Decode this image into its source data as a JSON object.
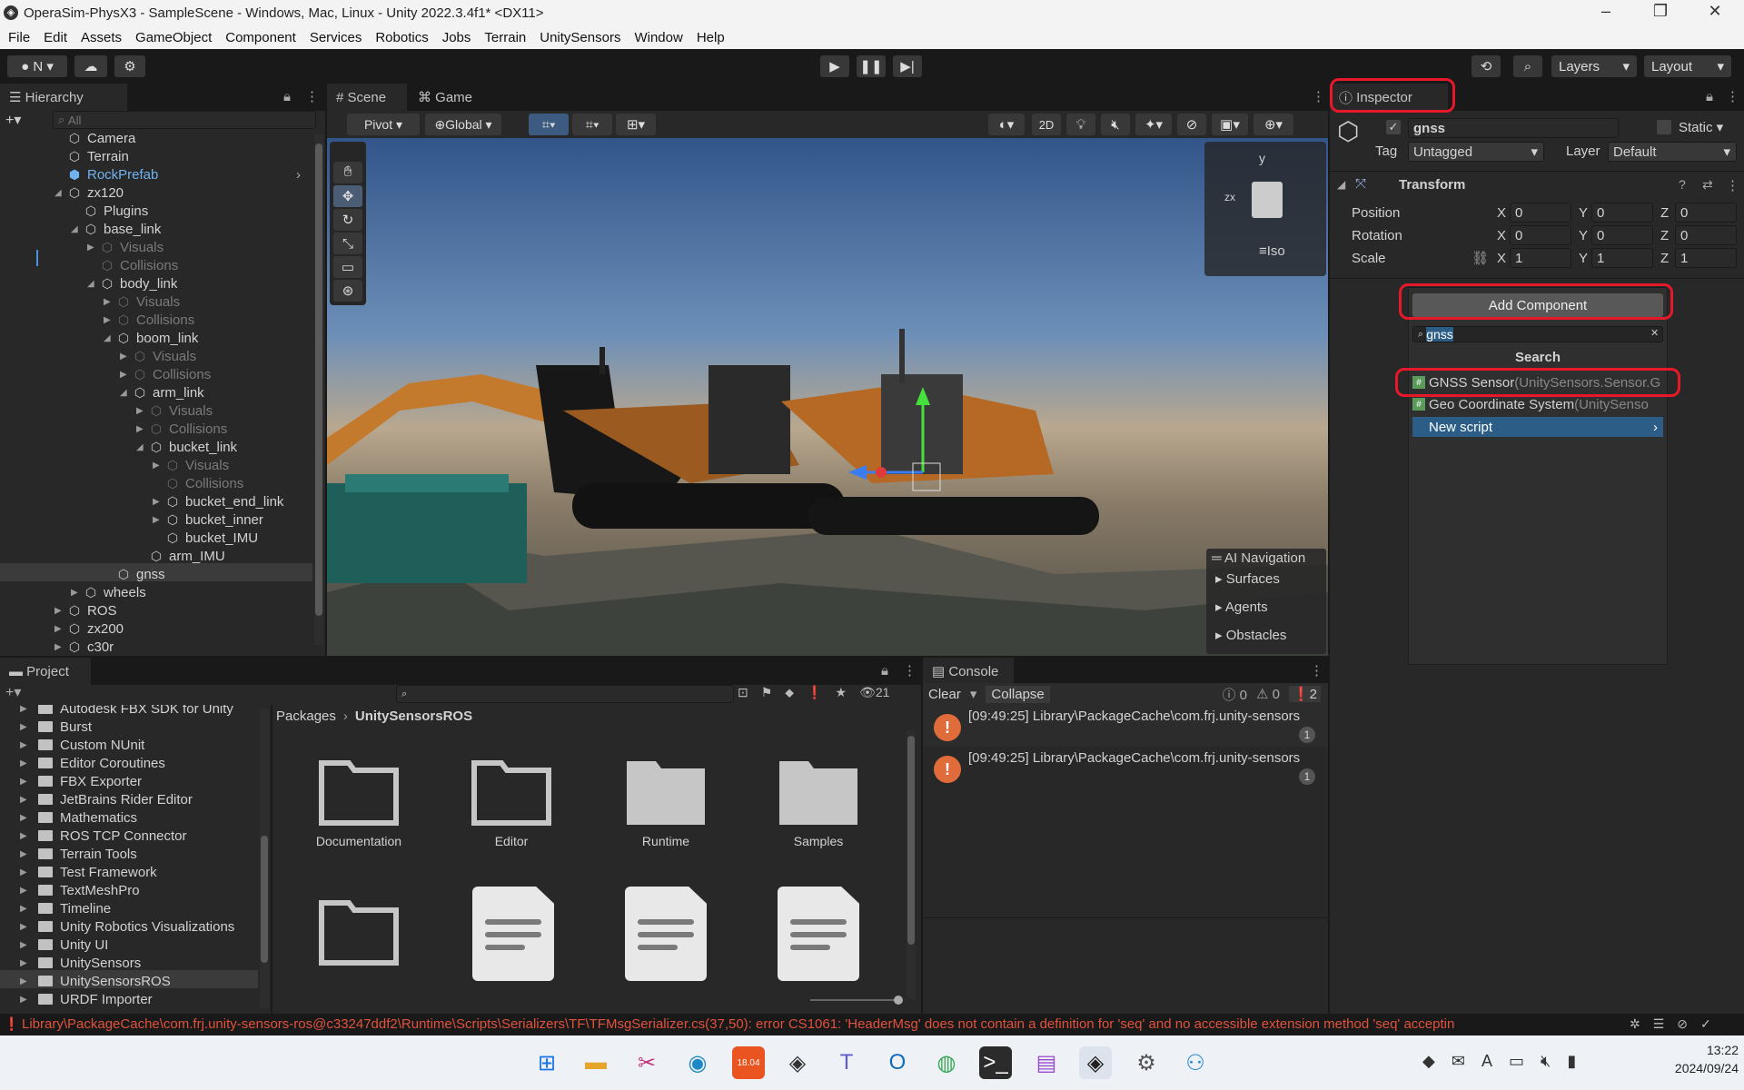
{
  "window": {
    "title": "OperaSim-PhysX3 - SampleScene - Windows, Mac, Linux - Unity 2022.3.4f1* <DX11>"
  },
  "menu": [
    "File",
    "Edit",
    "Assets",
    "GameObject",
    "Component",
    "Services",
    "Robotics",
    "Jobs",
    "Terrain",
    "UnitySensors",
    "Window",
    "Help"
  ],
  "toolbar": {
    "account_label": "N",
    "layers_label": "Layers",
    "layout_label": "Layout"
  },
  "hierarchy": {
    "tab_label": "Hierarchy",
    "search_placeholder": "All",
    "items": [
      {
        "label": "Camera"
      },
      {
        "label": "Terrain"
      },
      {
        "label": "RockPrefab"
      },
      {
        "label": "zx120"
      },
      {
        "label": "Plugins"
      },
      {
        "label": "base_link"
      },
      {
        "label": "Visuals"
      },
      {
        "label": "Collisions"
      },
      {
        "label": "body_link"
      },
      {
        "label": "Visuals"
      },
      {
        "label": "Collisions"
      },
      {
        "label": "boom_link"
      },
      {
        "label": "Visuals"
      },
      {
        "label": "Collisions"
      },
      {
        "label": "arm_link"
      },
      {
        "label": "Visuals"
      },
      {
        "label": "Collisions"
      },
      {
        "label": "bucket_link"
      },
      {
        "label": "Visuals"
      },
      {
        "label": "Collisions"
      },
      {
        "label": "bucket_end_link"
      },
      {
        "label": "bucket_inner"
      },
      {
        "label": "bucket_IMU"
      },
      {
        "label": "arm_IMU"
      },
      {
        "label": "gnss"
      },
      {
        "label": "wheels"
      },
      {
        "label": "ROS"
      },
      {
        "label": "zx200"
      },
      {
        "label": "c30r"
      }
    ]
  },
  "scene": {
    "tab_scene": "Scene",
    "tab_game": "Game",
    "pivot_label": "Pivot",
    "global_label": "Global",
    "twod_label": "2D",
    "gizmo_y": "y",
    "gizmo_zx": "zx",
    "iso_label": "Iso",
    "ai_nav": {
      "title": "AI Navigation",
      "items": [
        "Surfaces",
        "Agents",
        "Obstacles"
      ]
    }
  },
  "inspector": {
    "tab_label": "Inspector",
    "object_name": "gnss",
    "static_label": "Static",
    "tag_label": "Tag",
    "tag_value": "Untagged",
    "layer_label": "Layer",
    "layer_value": "Default",
    "transform_label": "Transform",
    "rows": [
      {
        "label": "Position",
        "x": "0",
        "y": "0",
        "z": "0"
      },
      {
        "label": "Rotation",
        "x": "0",
        "y": "0",
        "z": "0"
      },
      {
        "label": "Scale",
        "x": "1",
        "y": "1",
        "z": "1"
      }
    ],
    "axis_x": "X",
    "axis_y": "Y",
    "axis_z": "Z",
    "add_component_label": "Add Component",
    "search_value": "gnss",
    "search_header": "Search",
    "results": [
      {
        "name": "GNSS Sensor",
        "ns": "(UnitySensors.Sensor.G"
      },
      {
        "name": "Geo Coordinate System",
        "ns": "(UnitySenso"
      }
    ],
    "new_script_label": "New script"
  },
  "project": {
    "tab_label": "Project",
    "hidden_count": "21",
    "tree": [
      "Autodesk FBX SDK for Unity",
      "Burst",
      "Custom NUnit",
      "Editor Coroutines",
      "FBX Exporter",
      "JetBrains Rider Editor",
      "Mathematics",
      "ROS TCP Connector",
      "Terrain Tools",
      "Test Framework",
      "TextMeshPro",
      "Timeline",
      "Unity Robotics Visualizations",
      "Unity UI",
      "UnitySensors",
      "UnitySensorsROS",
      "URDF Importer"
    ],
    "breadcrumb_root": "Packages",
    "breadcrumb_current": "UnitySensorsROS",
    "assets": [
      "Documentation",
      "Editor",
      "Runtime",
      "Samples"
    ]
  },
  "console": {
    "tab_label": "Console",
    "clear_label": "Clear",
    "collapse_label": "Collapse",
    "info_count": "0",
    "warn_count": "0",
    "error_count": "2",
    "entries": [
      {
        "text": "[09:49:25] Library\\PackageCache\\com.frj.unity-sensors",
        "count": "1"
      },
      {
        "text": "[09:49:25] Library\\PackageCache\\com.frj.unity-sensors",
        "count": "1"
      }
    ]
  },
  "status_bar": {
    "error_text": "Library\\PackageCache\\com.frj.unity-sensors-ros@c33247ddf2\\Runtime\\Scripts\\Serializers\\TF\\TFMsgSerializer.cs(37,50): error CS1061: 'HeaderMsg' does not contain a definition for 'seq' and no accessible extension method 'seq' acceptin"
  },
  "taskbar": {
    "time": "13:22",
    "date": "2024/09/24",
    "badge": "18.04"
  },
  "colors": {
    "highlight": "#e8182a",
    "selection": "#2c5d87",
    "error": "#e06c3c"
  }
}
